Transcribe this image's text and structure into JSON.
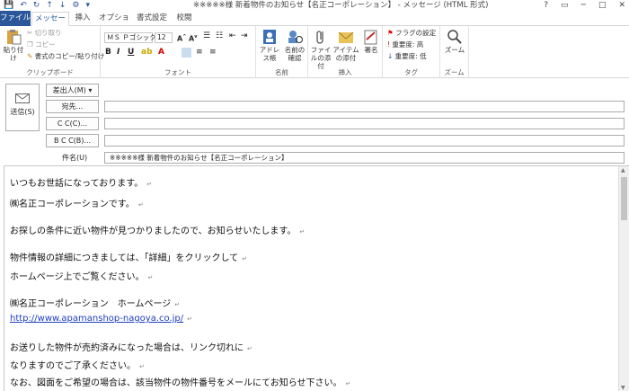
{
  "titlebar": {
    "quick_access": [
      "💾",
      "↶",
      "↻",
      "↑",
      "↓",
      "⚙",
      "▾"
    ],
    "title": "※※※※※様 新着物件のお知らせ【名正コーポレーション】 - メッセージ (HTML 形式)",
    "controls": [
      "?",
      "▭",
      "─",
      "□",
      "✕"
    ]
  },
  "tabs": [
    "ファイル",
    "メッセージ",
    "挿入",
    "オプション",
    "書式設定",
    "校閲"
  ],
  "ribbon": {
    "clipboard": {
      "paste": "貼り付け",
      "cut": "切り取り",
      "copy": "コピー",
      "format_painter": "書式のコピー/貼り付け",
      "label": "クリップボード"
    },
    "font": {
      "name": "ＭＳ Ｐゴシック",
      "size": "12",
      "label": "フォント"
    },
    "names": {
      "address_book": "アドレス帳",
      "check_names": "名前の確認",
      "label": "名前"
    },
    "insert": {
      "attach_file": "ファイルの添付",
      "attach_item": "アイテムの添付",
      "signature": "署名",
      "label": "挿入"
    },
    "tags": {
      "follow_up": "フラグの設定",
      "high": "重要度: 高",
      "low": "重要度: 低",
      "label": "タグ"
    },
    "zoom": {
      "zoom": "ズーム",
      "label": "ズーム"
    }
  },
  "header": {
    "send": "送信(S)",
    "from": "差出人(M)",
    "to": "宛先...",
    "cc": "C C(C)...",
    "bcc": "B C C(B)...",
    "subject_label": "件名(U)",
    "subject_value": "※※※※※様 新着物件のお知らせ【名正コーポレーション】"
  },
  "body": {
    "l1": "いつもお世話になっております。",
    "l2": "㈱名正コーポレーションです。",
    "l3": "お探しの条件に近い物件が見つかりましたので、お知らせいたします。",
    "l4": "物件情報の詳細につきましては、「詳細」をクリックして",
    "l5": "ホームページ上でご覧ください。",
    "l6": "㈱名正コーポレーション　ホームページ",
    "l7": "http://www.apamanshop-nagoya.co.jp/",
    "l8": "お送りした物件が売約済みになった場合は、リンク切れに",
    "l9": "なりますのでご了承ください。",
    "l10": "なお、図面をご希望の場合は、該当物件の物件番号をメールにてお知らせ下さい。"
  }
}
